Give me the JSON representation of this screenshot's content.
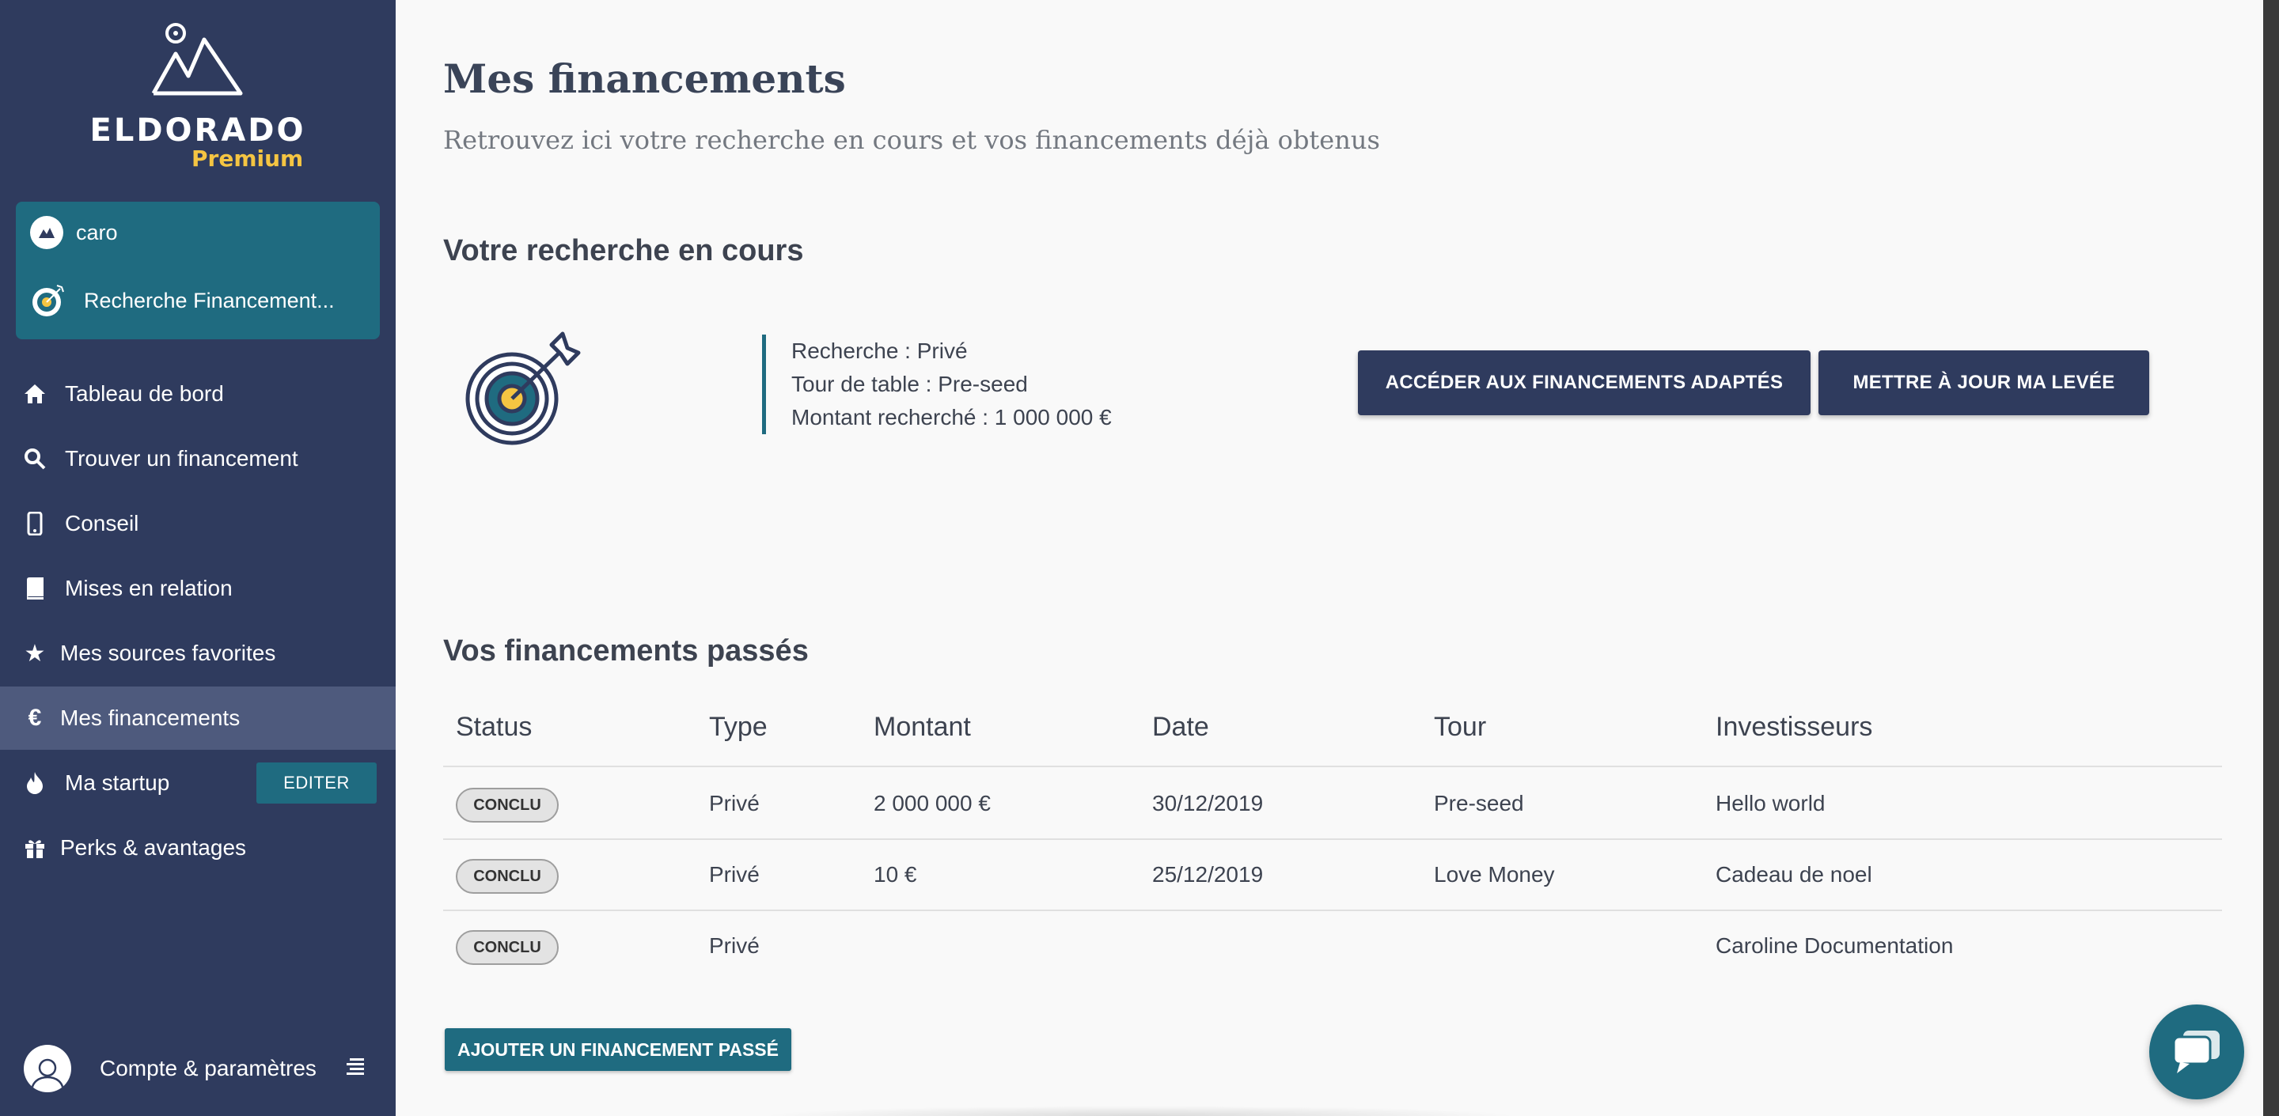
{
  "brand": {
    "name": "ELDORADO",
    "tier": "Premium",
    "colors": {
      "sidebar": "#2f3b5e",
      "teal": "#1f6b80",
      "accent": "#f5c542"
    }
  },
  "account_box": {
    "user": "caro",
    "project": "Recherche Financement..."
  },
  "sidebar": {
    "items": [
      {
        "label": "Tableau de bord",
        "icon": "home-icon"
      },
      {
        "label": "Trouver un financement",
        "icon": "search-icon"
      },
      {
        "label": "Conseil",
        "icon": "phone-icon"
      },
      {
        "label": "Mises en relation",
        "icon": "book-icon"
      },
      {
        "label": "Mes sources favorites",
        "icon": "star-icon"
      },
      {
        "label": "Mes financements",
        "icon": "euro-icon",
        "active": true
      },
      {
        "label": "Ma startup",
        "icon": "fire-icon"
      },
      {
        "label": "Perks & avantages",
        "icon": "gift-icon"
      }
    ],
    "edit_label": "EDITER",
    "account_label": "Compte & paramètres"
  },
  "header": {
    "title": "Mes financements",
    "subtitle": "Retrouvez ici votre recherche en cours et vos financements déjà obtenus"
  },
  "current_search": {
    "section_title": "Votre recherche en cours",
    "lines": [
      "Recherche : Privé",
      "Tour de table : Pre-seed",
      "Montant recherché : 1 000 000 €"
    ],
    "access_button": "ACCÉDER AUX FINANCEMENTS ADAPTÉS",
    "update_button": "METTRE À JOUR MA LEVÉE"
  },
  "past_funding": {
    "section_title": "Vos financements passés",
    "columns": [
      "Status",
      "Type",
      "Montant",
      "Date",
      "Tour",
      "Investisseurs"
    ],
    "rows": [
      {
        "status": "CONCLU",
        "type": "Privé",
        "amount": "2 000 000 €",
        "date": "30/12/2019",
        "round": "Pre-seed",
        "investors": "Hello world"
      },
      {
        "status": "CONCLU",
        "type": "Privé",
        "amount": "10 €",
        "date": "25/12/2019",
        "round": "Love Money",
        "investors": "Cadeau de noel"
      },
      {
        "status": "CONCLU",
        "type": "Privé",
        "amount": "",
        "date": "",
        "round": "",
        "investors": "Caroline Documentation"
      }
    ],
    "add_button": "AJOUTER UN FINANCEMENT PASSÉ"
  }
}
